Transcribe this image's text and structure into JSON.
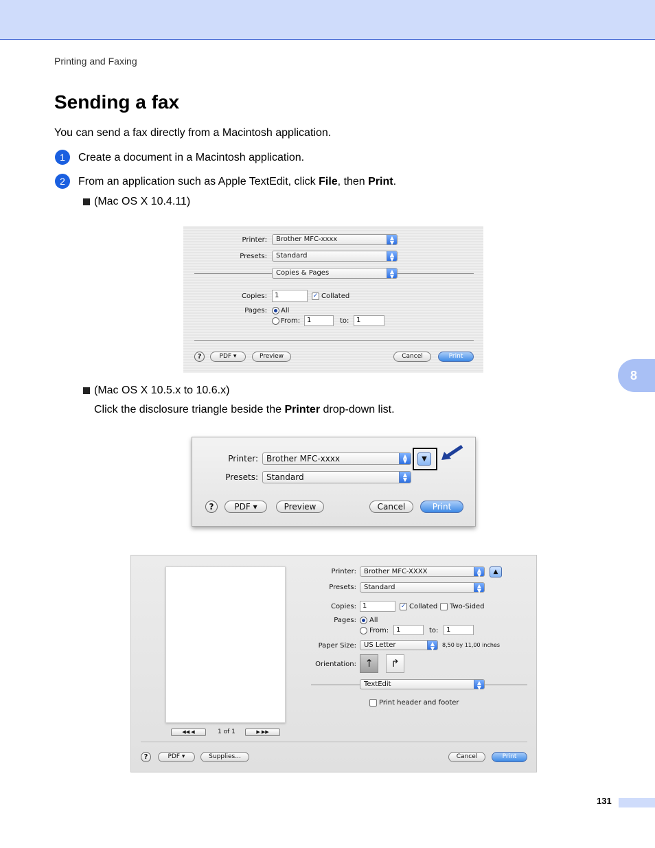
{
  "header": {
    "section": "Printing and Faxing"
  },
  "title": "Sending a fax",
  "intro": "You can send a fax directly from a Macintosh application.",
  "steps": [
    {
      "num": "1",
      "text": "Create a document in a Macintosh application."
    },
    {
      "num": "2",
      "pre": "From an application such as Apple TextEdit, click ",
      "b1": "File",
      "mid": ", then ",
      "b2": "Print",
      "post": "."
    }
  ],
  "bullets": {
    "b1": "(Mac OS X 10.4.11)",
    "b2": "(Mac OS X 10.5.x to 10.6.x)",
    "b2_pre": "Click the disclosure triangle beside the ",
    "b2_bold": "Printer",
    "b2_post": " drop-down list."
  },
  "dialog1": {
    "printer_label": "Printer:",
    "printer_value": "Brother MFC-xxxx",
    "presets_label": "Presets:",
    "presets_value": "Standard",
    "section_value": "Copies & Pages",
    "copies_label": "Copies:",
    "copies_value": "1",
    "collated": "Collated",
    "pages_label": "Pages:",
    "all": "All",
    "from": "From:",
    "from_value": "1",
    "to": "to:",
    "to_value": "1",
    "help": "?",
    "pdf": "PDF ▾",
    "preview": "Preview",
    "cancel": "Cancel",
    "print": "Print"
  },
  "dialog2": {
    "printer_label": "Printer:",
    "printer_value": "Brother MFC-xxxx",
    "presets_label": "Presets:",
    "presets_value": "Standard",
    "help": "?",
    "pdf": "PDF ▾",
    "preview": "Preview",
    "cancel": "Cancel",
    "print": "Print",
    "disclosure": "▼"
  },
  "dialog3": {
    "printer_label": "Printer:",
    "printer_value": "Brother MFC-XXXX",
    "presets_label": "Presets:",
    "presets_value": "Standard",
    "copies_label": "Copies:",
    "copies_value": "1",
    "collated": "Collated",
    "two_sided": "Two-Sided",
    "pages_label": "Pages:",
    "all": "All",
    "from": "From:",
    "from_value": "1",
    "to": "to:",
    "to_value": "1",
    "paper_label": "Paper Size:",
    "paper_value": "US Letter",
    "paper_dims": "8,50 by 11,00 inches",
    "orientation_label": "Orientation:",
    "app_value": "TextEdit",
    "header_footer": "Print header and footer",
    "page_counter": "1 of 1",
    "help": "?",
    "pdf": "PDF ▾",
    "supplies": "Supplies...",
    "cancel": "Cancel",
    "print": "Print",
    "collapse": "▲"
  },
  "page_number": "131",
  "chapter_tab": "8",
  "colors": {
    "accent": "#1a5fe0",
    "band": "#cfdcfb"
  }
}
